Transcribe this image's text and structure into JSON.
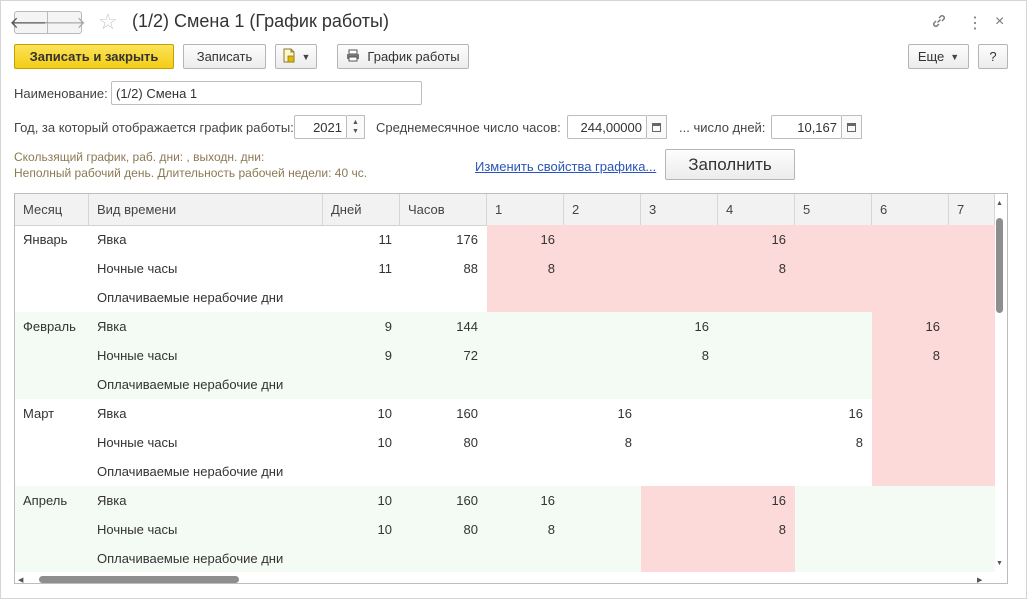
{
  "window": {
    "title": "(1/2) Смена 1 (График работы)",
    "back_icon": "🡐",
    "forward_icon": "🡒"
  },
  "toolbar": {
    "save_close_label": "Записать и закрыть",
    "save_label": "Записать",
    "schedule_label": "График работы",
    "more_label": "Еще",
    "help_label": "?"
  },
  "form": {
    "name_label": "Наименование:",
    "name_value": "(1/2) Смена 1",
    "year_label": "Год, за который отображается график работы:",
    "year_value": "2021",
    "avg_hours_label": "Среднемесячное число часов:",
    "avg_hours_value": "244,00000",
    "days_label": "... число дней:",
    "days_value": "10,167",
    "info_line1": "Скользящий график, раб. дни: , выходн. дни:",
    "info_line2": "Неполный рабочий день. Длительность рабочей недели: 40 чс.",
    "change_link": "Изменить свойства графика...",
    "fill_label": "Заполнить"
  },
  "table": {
    "columns": [
      "Месяц",
      "Вид времени",
      "Дней",
      "Часов",
      "1",
      "2",
      "3",
      "4",
      "5",
      "6",
      "7"
    ],
    "months": [
      {
        "month": "Январь",
        "rows": [
          {
            "type": "Явка",
            "days": "11",
            "hours": "176",
            "cells": [
              "16",
              "",
              "",
              "16",
              "",
              "",
              ""
            ]
          },
          {
            "type": "Ночные часы",
            "days": "11",
            "hours": "88",
            "cells": [
              "8",
              "",
              "",
              "8",
              "",
              "",
              ""
            ]
          },
          {
            "type": "Оплачиваемые нерабочие дни",
            "days": "",
            "hours": "",
            "cells": [
              "",
              "",
              "",
              "",
              "",
              "",
              ""
            ]
          }
        ]
      },
      {
        "month": "Февраль",
        "rows": [
          {
            "type": "Явка",
            "days": "9",
            "hours": "144",
            "cells": [
              "",
              "",
              "16",
              "",
              "",
              "16",
              ""
            ]
          },
          {
            "type": "Ночные часы",
            "days": "9",
            "hours": "72",
            "cells": [
              "",
              "",
              "8",
              "",
              "",
              "8",
              ""
            ]
          },
          {
            "type": "Оплачиваемые нерабочие дни",
            "days": "",
            "hours": "",
            "cells": [
              "",
              "",
              "",
              "",
              "",
              "",
              ""
            ]
          }
        ]
      },
      {
        "month": "Март",
        "rows": [
          {
            "type": "Явка",
            "days": "10",
            "hours": "160",
            "cells": [
              "",
              "16",
              "",
              "",
              "16",
              "",
              ""
            ]
          },
          {
            "type": "Ночные часы",
            "days": "10",
            "hours": "80",
            "cells": [
              "",
              "8",
              "",
              "",
              "8",
              "",
              ""
            ]
          },
          {
            "type": "Оплачиваемые нерабочие дни",
            "days": "",
            "hours": "",
            "cells": [
              "",
              "",
              "",
              "",
              "",
              "",
              ""
            ]
          }
        ]
      },
      {
        "month": "Апрель",
        "rows": [
          {
            "type": "Явка",
            "days": "10",
            "hours": "160",
            "cells": [
              "16",
              "",
              "",
              "16",
              "",
              "",
              ""
            ]
          },
          {
            "type": "Ночные часы",
            "days": "10",
            "hours": "80",
            "cells": [
              "8",
              "",
              "",
              "8",
              "",
              "",
              ""
            ]
          },
          {
            "type": "Оплачиваемые нерабочие дни",
            "days": "",
            "hours": "",
            "cells": [
              "",
              "",
              "",
              "",
              "",
              "",
              ""
            ]
          }
        ]
      }
    ],
    "holiday_days": [
      [
        1,
        2,
        3,
        4,
        5,
        6,
        7
      ],
      [
        6,
        7
      ],
      [
        6,
        7
      ],
      [
        3,
        4
      ]
    ]
  },
  "colors": {
    "accent_yellow": "#f4cd14",
    "holiday_pink": "#fddada",
    "alt_row_green": "#f4faf4",
    "link_blue": "#2a55b6"
  }
}
